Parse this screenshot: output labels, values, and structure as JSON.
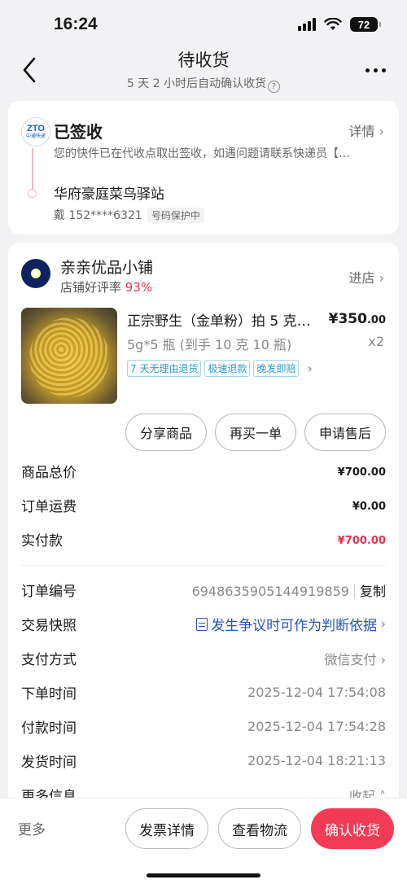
{
  "status_bar": {
    "time": "16:24",
    "battery": "72"
  },
  "nav": {
    "title": "待收货",
    "subtitle": "5 天 2 小时后自动确认收货"
  },
  "logistics": {
    "carrier_logo_text": "ZTO",
    "carrier_logo_sub": "中通快递",
    "status": "已签收",
    "detail_label": "详情",
    "description": "您的快件已在代收点取出签收，如遇问题请联系快递员【…",
    "station": "华府豪庭菜鸟驿站",
    "contact": "戴 152****6321",
    "privacy_tag": "号码保护中"
  },
  "shop": {
    "name": "亲亲优品小铺",
    "rating_label": "店铺好评率",
    "rating_value": "93%",
    "enter_label": "进店"
  },
  "product": {
    "title": "正宗野生（金单粉）拍 5 克…",
    "price_main": "¥350",
    "price_decimal": ".00",
    "spec": "5g*5 瓶 (到手 10 克 10 瓶)",
    "quantity": "x2",
    "tags": [
      "7 天无理由退货",
      "极速退款",
      "晚发即赔"
    ]
  },
  "actions": {
    "share": "分享商品",
    "rebuy": "再买一单",
    "after_sale": "申请售后"
  },
  "fees": {
    "total_label": "商品总价",
    "total_main": "¥700",
    "total_decimal": ".00",
    "shipping_label": "订单运费",
    "shipping_main": "¥0",
    "shipping_decimal": ".00",
    "paid_label": "实付款",
    "paid_main": "¥700",
    "paid_decimal": ".00"
  },
  "order_info": {
    "order_no_label": "订单编号",
    "order_no": "6948635905144919859",
    "copy_label": "复制",
    "snapshot_label": "交易快照",
    "snapshot_link": "发生争议时可作为判断依据",
    "payment_label": "支付方式",
    "payment_value": "微信支付",
    "order_time_label": "下单时间",
    "order_time": "2025-12-04 17:54:08",
    "pay_time_label": "付款时间",
    "pay_time": "2025-12-04 17:54:28",
    "ship_time_label": "发货时间",
    "ship_time": "2025-12-04 18:21:13",
    "more_label": "更多信息",
    "collapse_label": "收起"
  },
  "bottom_bar": {
    "more": "更多",
    "invoice": "发票详情",
    "logistics": "查看物流",
    "confirm": "确认收货"
  },
  "colors": {
    "accent": "#f23b55",
    "link": "#2356b8",
    "tag": "#2a9cc8"
  }
}
